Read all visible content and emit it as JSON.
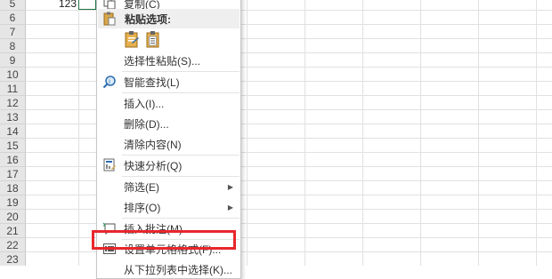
{
  "rows": [
    "5",
    "6",
    "7",
    "8",
    "9",
    "10",
    "11",
    "12",
    "13",
    "14",
    "15",
    "16",
    "17",
    "18",
    "19",
    "20",
    "21",
    "22",
    "23"
  ],
  "cell_value": "123",
  "menu": {
    "copy_label": "复制(C)",
    "paste_header": "粘贴选项:",
    "paste_special": "选择性粘贴(S)...",
    "smart_lookup": "智能查找(L)",
    "insert": "插入(I)...",
    "delete": "删除(D)...",
    "clear_contents": "清除内容(N)",
    "quick_analysis": "快速分析(Q)",
    "filter": "筛选(E)",
    "sort": "排序(O)",
    "insert_comment": "插入批注(M)",
    "format_cells": "设置单元格格式(F)...",
    "pick_from_list": "从下拉列表中选择(K)..."
  },
  "colors": {
    "highlight": "#e8262c",
    "accent": "#217346"
  }
}
